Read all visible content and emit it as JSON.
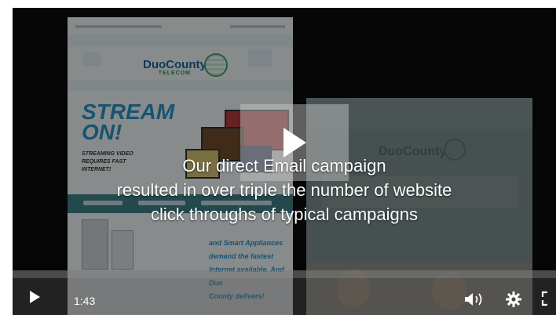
{
  "video": {
    "caption_lines": [
      "Our direct Email campaign",
      "resulted in over triple the number of website",
      "click throughs of typical campaigns"
    ],
    "current_time": "1:43",
    "big_play_icon": "play-icon",
    "control_icons": [
      "play-icon",
      "volume-icon",
      "gear-icon",
      "fullscreen-icon"
    ]
  },
  "email_left": {
    "logo_name": "DuoCounty",
    "logo_sub": "TELECOM",
    "headline": "STREAM ON!",
    "subhead": "STREAMING VIDEO REQUIRES FAST INTERNET!",
    "body_lines": [
      "and Smart Appliances",
      "demand the fastest",
      "Internet available. And Duo",
      "County delivers!"
    ]
  },
  "email_right": {
    "logo_name": "DuoCounty"
  }
}
